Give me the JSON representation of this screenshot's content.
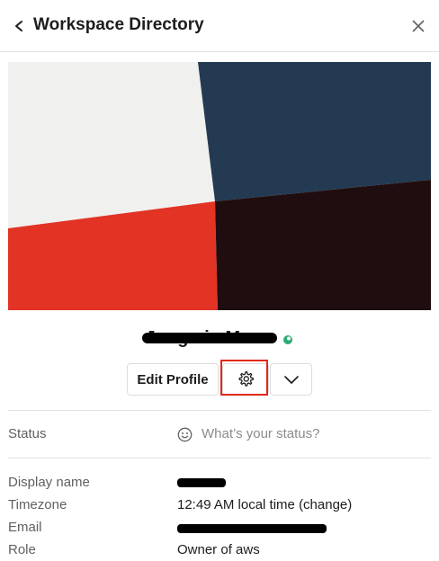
{
  "header": {
    "title": "Workspace Directory"
  },
  "profile": {
    "name": "Jongmin Moon",
    "edit_label": "Edit Profile"
  },
  "status": {
    "label": "Status",
    "placeholder": "What’s your status?"
  },
  "fields": {
    "display_name_label": "Display name",
    "timezone_label": "Timezone",
    "timezone_value": "12:49 AM local time (change)",
    "email_label": "Email",
    "role_label": "Role",
    "role_value": "Owner of aws"
  },
  "icons": {
    "back": "chevron-left-icon",
    "close": "close-icon",
    "settings": "gear-icon",
    "more": "chevron-down-icon",
    "status": "smiley-icon",
    "presence": "presence-icon"
  },
  "colors": {
    "highlight": "#e0291b",
    "presence": "#2bac76",
    "cover_white": "#f0f0ee",
    "cover_blue": "#233a52",
    "cover_red": "#e23325",
    "cover_dark": "#1f0d0f"
  }
}
